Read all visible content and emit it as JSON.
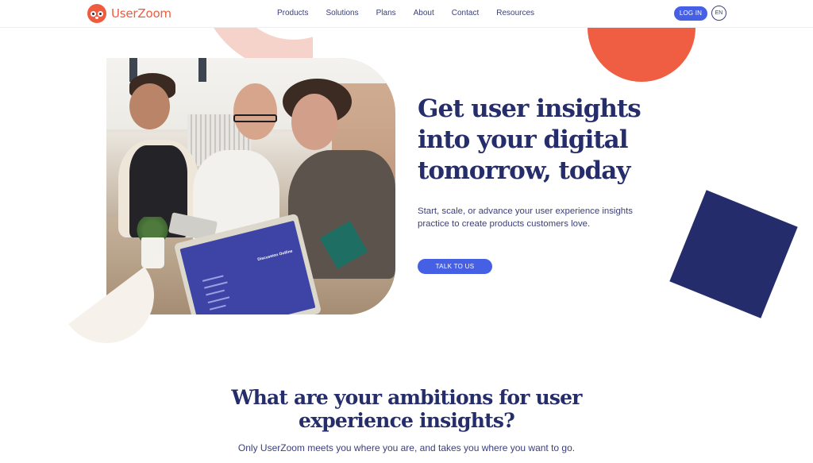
{
  "header": {
    "brand": "UserZoom",
    "nav": [
      "Products",
      "Solutions",
      "Plans",
      "About",
      "Contact",
      "Resources"
    ],
    "login_label": "LOG IN",
    "language_label": "EN"
  },
  "hero": {
    "title_lines": [
      "Get user insights",
      "into your digital",
      "tomorrow, today"
    ],
    "subtitle": "Start, scale, or advance your user experience insights practice to create products customers love.",
    "cta_label": "TALK TO US",
    "photo_alt": "Team collaborating around a laptop and tablet",
    "laptop_screen_text": "Discussion Outline"
  },
  "section": {
    "title_lines": [
      "What are your ambitions for user",
      "experience insights?"
    ],
    "subtitle": "Only UserZoom meets you where you are, and takes you where you want to go."
  },
  "colors": {
    "brand_orange": "#ef5b3f",
    "primary_blue": "#4660e5",
    "navy": "#262d6b",
    "pink_arc": "#f6d3ca",
    "cream": "#f7f1ec"
  }
}
